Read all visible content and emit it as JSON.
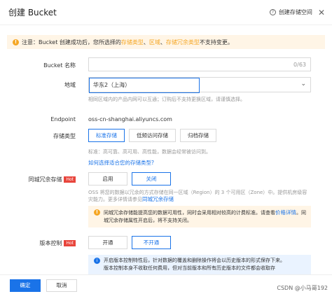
{
  "header": {
    "title": "创建 Bucket",
    "help_label": "创建存储空间",
    "help_icon": "help-circle-icon",
    "close_icon": "close-icon"
  },
  "notice": {
    "prefix": "注意：Bucket 创建成功后，您所选择的",
    "highlight_1": "存储类型",
    "sep_1": "、",
    "highlight_2": "区域",
    "sep_2": "、",
    "highlight_3": "存储冗余类型",
    "suffix": "不支持变更。"
  },
  "form": {
    "bucket_name": {
      "label": "Bucket 名称",
      "value": "",
      "counter": "0/63"
    },
    "region": {
      "label": "地域",
      "value": "华东2（上海）",
      "hint": "相同区域内的产品内网可以互通；订购后不支持更换区域，请谨慎选择。"
    },
    "endpoint": {
      "label": "Endpoint",
      "value": "oss-cn-shanghai.aliyuncs.com"
    },
    "storage_class": {
      "label": "存储类型",
      "options": [
        "标准存储",
        "低频访问存储",
        "归档存储"
      ],
      "selected": "标准存储",
      "hint": "标准：高可靠、高可用、高性能，数据会经常被访问到。",
      "link": "如何选择适合您的存储类型?"
    },
    "redundancy": {
      "label": "同城冗余存储",
      "badge": "Hot",
      "options": [
        "启用",
        "关闭"
      ],
      "selected": "关闭",
      "desc_1": "OSS 将您的数据以冗余的方式存储在同一区域（Region）的 3 个可用区（Zone）中。提供机房级容灾能力。更多详情请参见",
      "desc_link": "同城冗余存储",
      "warn_1": "同城冗余存储能提高您的数据可用性，同时会采用相对较高的计费标准。请查看",
      "warn_link": "价格详情",
      "warn_2": "。同城冗余存储属性开启后，将不支持关闭。"
    },
    "versioning": {
      "label": "版本控制",
      "badge": "Hot",
      "options": [
        "开通",
        "不开通"
      ],
      "selected": "不开通",
      "info_1": "开启版本控制特性后，针对数据的覆盖和删除操作将会以历史版本的形式保存下来。",
      "info_2": "版本控制本身不收取任何费用，但对当前版本和所有历史版本的文件都会收取存"
    }
  },
  "footer": {
    "confirm": "确定",
    "cancel": "取消"
  },
  "watermark": "CSDN @小马哥192",
  "colors": {
    "primary": "#1a73e8",
    "warning": "#f5a623",
    "hot": "#e8453c"
  }
}
